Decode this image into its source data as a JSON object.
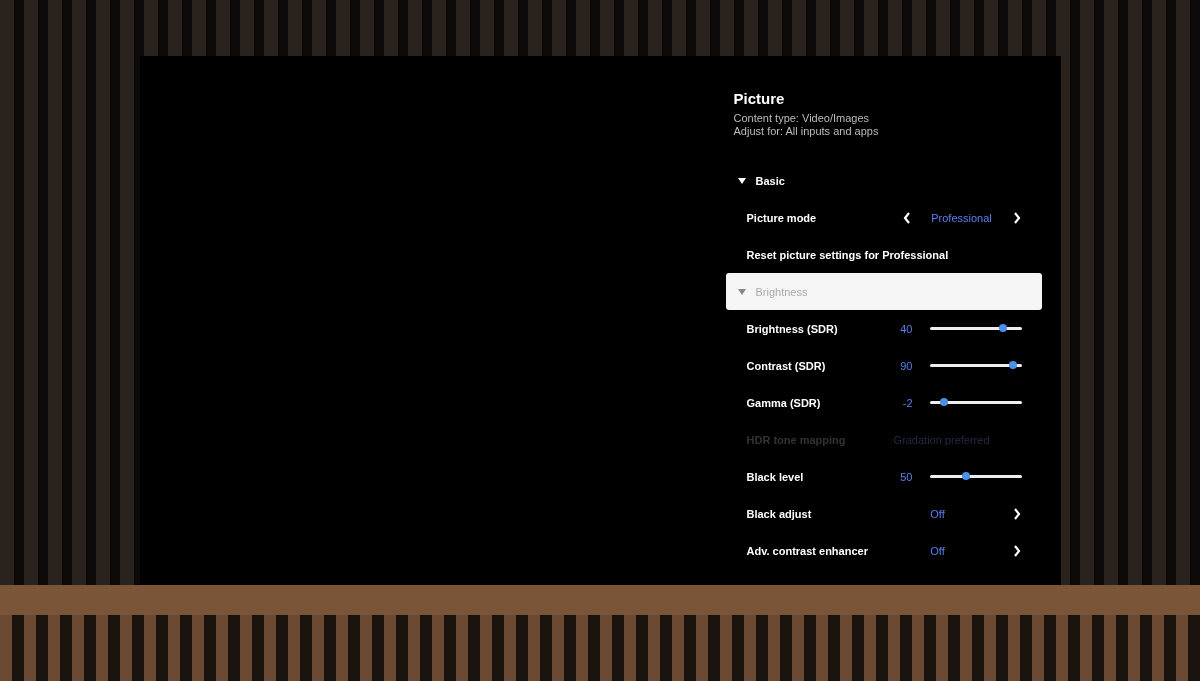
{
  "menu": {
    "title": "Picture",
    "subtitle_lines": [
      "Content type: Video/Images",
      "Adjust for: All inputs and apps"
    ],
    "items": [
      {
        "kind": "section",
        "label": "Basic",
        "expanded": true,
        "selected": false,
        "disabled": false
      },
      {
        "kind": "selector",
        "label": "Picture mode",
        "value": "Professional",
        "selected": false,
        "disabled": false
      },
      {
        "kind": "action",
        "label": "Reset picture settings for Professional",
        "selected": false,
        "disabled": false
      },
      {
        "kind": "section",
        "label": "Brightness",
        "expanded": true,
        "selected": true,
        "disabled": false
      },
      {
        "kind": "slider",
        "label": "Brightness (SDR)",
        "value": "40",
        "level": 0.8,
        "selected": false,
        "disabled": false
      },
      {
        "kind": "slider",
        "label": "Contrast (SDR)",
        "value": "90",
        "level": 0.91,
        "selected": false,
        "disabled": false
      },
      {
        "kind": "slider",
        "label": "Gamma (SDR)",
        "value": "-2",
        "level": 0.16,
        "selected": false,
        "disabled": false
      },
      {
        "kind": "option",
        "label": "HDR tone mapping",
        "value": "Gradation preferred",
        "selected": false,
        "disabled": true
      },
      {
        "kind": "slider",
        "label": "Black level",
        "value": "50",
        "level": 0.4,
        "selected": false,
        "disabled": false
      },
      {
        "kind": "link",
        "label": "Black adjust",
        "value": "Off",
        "selected": false,
        "disabled": false
      },
      {
        "kind": "link",
        "label": "Adv. contrast enhancer",
        "value": "Off",
        "selected": false,
        "disabled": false
      }
    ]
  }
}
